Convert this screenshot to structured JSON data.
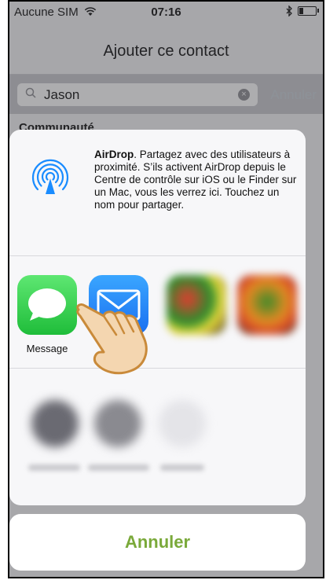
{
  "status_bar": {
    "carrier": "Aucune SIM",
    "time": "07:16"
  },
  "nav": {
    "title": "Ajouter ce contact"
  },
  "search": {
    "value": "Jason",
    "cancel_label": "Annuler"
  },
  "list": {
    "section_header": "Communauté"
  },
  "share_sheet": {
    "airdrop": {
      "title": "AirDrop",
      "description": ". Partagez avec des utilisateurs à proximité. S’ils activent AirDrop depuis le Centre de contrôle sur iOS ou le Finder sur un Mac, vous les verrez ici. Touchez un nom pour partager."
    },
    "apps": [
      {
        "label": "Message",
        "icon": "messages-icon"
      },
      {
        "label": "",
        "icon": "mail-icon"
      },
      {
        "label": "",
        "icon": "blurred-app-icon"
      },
      {
        "label": "",
        "icon": "blurred-app-icon"
      }
    ],
    "cancel_label": "Annuler"
  },
  "colors": {
    "accent": "#7aa93a",
    "airdrop_blue": "#1a8cff"
  }
}
